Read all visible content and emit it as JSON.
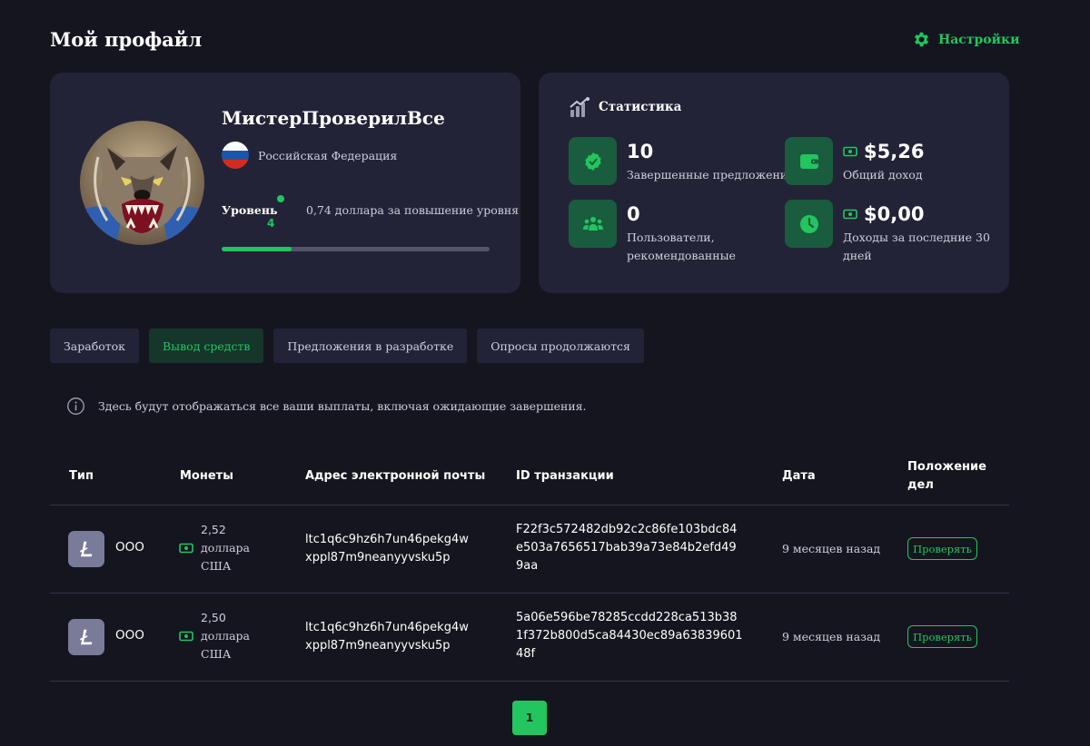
{
  "page": {
    "title": "Мой профайл",
    "settings_label": "Настройки"
  },
  "colors": {
    "accent": "#22c55e",
    "card": "#232337",
    "background": "#15151f"
  },
  "profile": {
    "username": "МистерПроверилВсе",
    "country": "Российская Федерация",
    "level_label": "Уровень",
    "level": "4",
    "next_level_text": "0,74 доллара за повышение уровня",
    "level_progress_percent": 26
  },
  "stats": {
    "title": "Статистика",
    "completed_offers": {
      "value": "10",
      "label": "Завершенные предложения"
    },
    "total_income": {
      "value": "$5,26",
      "label": "Общий доход"
    },
    "referred_users": {
      "value": "0",
      "label_line1": "Пользователи,",
      "label_line2": "рекомендованные"
    },
    "income_30_days": {
      "value": "$0,00",
      "label_line1": "Доходы за последние 30",
      "label_line2": "дней"
    }
  },
  "tabs": [
    {
      "label": "Заработок",
      "active": false
    },
    {
      "label": "Вывод средств",
      "active": true
    },
    {
      "label": "Предложения в разработке",
      "active": false
    },
    {
      "label": "Опросы продолжаются",
      "active": false
    }
  ],
  "info_text": "Здесь будут отображаться все ваши выплаты, включая ожидающие завершения.",
  "table": {
    "headers": {
      "type": "Тип",
      "coins": "Монеты",
      "email": "Адрес электронной почты",
      "txid": "ID транзакции",
      "date": "Дата",
      "status_line1": "Положение",
      "status_line2": "дел"
    },
    "rows": [
      {
        "type_icon": "litecoin-icon",
        "type": "OOO",
        "amount": "2,52",
        "currency_line1": "доллара",
        "currency_line2": "США",
        "email_line1": "ltc1q6c9hz6h7un46pekg4w",
        "email_line2": "xppl87m9neanyyvsku5p",
        "txid": "F22f3c572482db92c2c86fe103bdc84e503a7656517bab39a73e84b2efd499aa",
        "date": "9 месяцев назад",
        "action": "Проверять"
      },
      {
        "type_icon": "litecoin-icon",
        "type": "OOO",
        "amount": "2,50",
        "currency_line1": "доллара",
        "currency_line2": "США",
        "email_line1": "ltc1q6c9hz6h7un46pekg4w",
        "email_line2": "xppl87m9neanyyvsku5p",
        "txid": "5a06e596be78285ccdd228ca513b381f372b800d5ca84430ec89a6383960148f",
        "date": "9 месяцев назад",
        "action": "Проверять"
      }
    ]
  },
  "pagination": {
    "current": "1"
  }
}
